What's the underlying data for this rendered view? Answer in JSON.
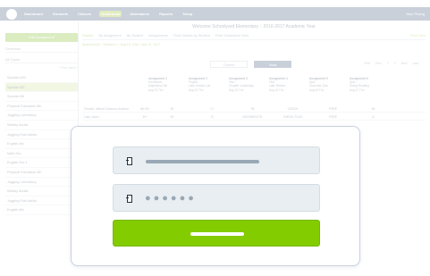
{
  "app": {
    "nav": [
      "Dashboard",
      "Students",
      "Classes",
      "Gradebook",
      "Attendance",
      "Reports",
      "Setup"
    ],
    "nav_active_index": 3,
    "user_name": "Blue Phang",
    "school_title": "Welcome Schoolyard Elementary :: 2016-2017 Academic Year"
  },
  "sidebar": {
    "add_button": "Add Assignment",
    "filter_term": "Semester",
    "filter_type": "All Types",
    "pager": "« Prev  Next »",
    "classes": [
      "Spanish A22",
      "Spanish B3",
      "Spanish B4",
      "Physical Education 9th",
      "Jogging Laboratory",
      "Military Adults",
      "Jogging Kids Adults",
      "English Ms",
      "Math Hrs",
      "English Hrs 1",
      "Physical Education 9th",
      "Jogging Laboratory",
      "Military Adults",
      "Jogging Kids Adults",
      "English 8th"
    ],
    "active_index": 1
  },
  "main": {
    "tabs": [
      "Grades",
      "By Assignment",
      "By Student",
      "Assignments",
      "Final Grades by Student",
      "Final Gradebook View"
    ],
    "active_tab": 0,
    "print_link": "Print View",
    "crumb": "Spanish A22 :: Session 1 :: Aug 15, 2016 - Mar 11, 2017",
    "toggle": [
      "Current",
      "Totals"
    ],
    "grade_pager": [
      "First",
      "Prev",
      "1",
      "2",
      "Next",
      "Last"
    ],
    "assignments": [
      {
        "title": "Assignment 1",
        "type": "Homework",
        "desc": "Adjectives Drill",
        "due": "Aug 12 Thu"
      },
      {
        "title": "Assignment 2",
        "type": "Project",
        "desc": "Latin Oration Lab",
        "due": "Aug 12 Thu"
      },
      {
        "title": "Assignment 3",
        "type": "Test",
        "desc": "Chapter Vocabulary",
        "due": "Aug 15 Thu"
      },
      {
        "title": "Assignment 4",
        "type": "Test",
        "desc": "Latin Review",
        "due": "Aug 15 Thu"
      },
      {
        "title": "Assignment 5",
        "type": "Quiz",
        "desc": "Grammar Quiz",
        "due": "Aug 25 Thu"
      },
      {
        "title": "Assignment 6",
        "type": "Quiz",
        "desc": "Dialog Reading",
        "due": "Aug 27 Thu"
      }
    ],
    "students": [
      {
        "name": "Fomulo, Marcel Solomon Antonio",
        "avg": "86.0%",
        "grades": [
          "90",
          "C+",
          "99",
          "CHECK",
          "FREE",
          "96"
        ]
      },
      {
        "name": "Calo, Ana J",
        "avg": "B+",
        "grades": [
          "90",
          "B",
          "INCOMPLETE",
          "CHECK PLUS",
          "FREE",
          "A"
        ]
      }
    ]
  },
  "login_form": {
    "username_value": "",
    "password_mask": "●●●●●●",
    "submit_label": ""
  },
  "colors": {
    "login_button": "#83cc00",
    "field_bg": "#e8eef1",
    "topbar": "#5a6f8c"
  }
}
